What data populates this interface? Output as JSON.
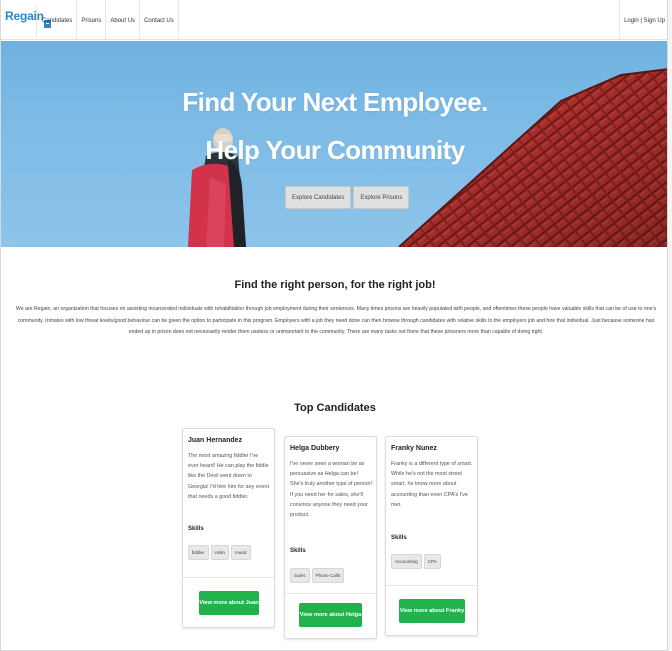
{
  "nav": {
    "brand": "Regain",
    "links": [
      "Candidates",
      "Prisons",
      "About Us",
      "Contact Us"
    ],
    "auth": "Login | Sign Up"
  },
  "hero": {
    "title_line1": "Find Your Next Employee.",
    "title_line2": "Help Your Community",
    "buttons": [
      "Explore Candidates",
      "Explore Prisons"
    ]
  },
  "about": {
    "title": "Find the right person, for the right job!",
    "text": "We are Regain, an organization that focuses on assisting incarcerated individuals with rehabilitation through job employment during their sentences. Many times prisons are heavily populated with people, and oftentimes these people have valuable skills that can be of use to one's community. Inmates with low threat levels/good behaviour can be given the option to participate in this program. Employers with a job they need done can then browse through candidates with relative skills to the employers job and hire that individual. Just because someone has ended up in prison does not necessarily render them useless or unimportant to the community. There are many tasks out there that these prisoners more than capable of doing right."
  },
  "candidates": {
    "title": "Top Candidates",
    "skills_label": "Skills",
    "items": [
      {
        "name": "Juan Hernandez",
        "description": "The most amazing fiddler I've ever heard! He can play the fiddle like the Devil went down to Georgia! I'd hire him for any event that needs a good fiddler.",
        "skills": [
          "fiddler",
          "violin",
          "music"
        ],
        "button": "View more about Juan"
      },
      {
        "name": "Helga Dubbery",
        "description": "I've never seen a woman be as persuasive as Helga can be! She's truly another type of person! If you need her for sales, she'll convince anyone they need your product.",
        "skills": [
          "Sales",
          "Phone Calls"
        ],
        "button": "View more about Helga"
      },
      {
        "name": "Franky Nunez",
        "description": "Franky is a different type of smart. While he's not the most street smart, he know more about accounting than even CPA's I've met.",
        "skills": [
          "Accounting",
          "CPA"
        ],
        "button": "View more about Franky"
      }
    ]
  },
  "colors": {
    "brand": "#2e86c7",
    "button_green": "#22b24c",
    "sky": "#7dbbe6",
    "roof": "#b8322f"
  }
}
